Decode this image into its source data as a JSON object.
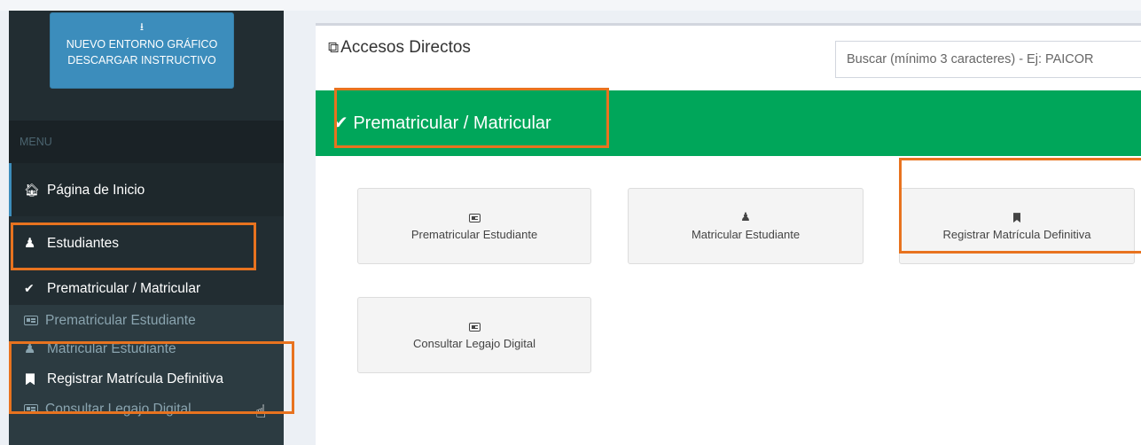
{
  "sidebar": {
    "download_button": {
      "icon": "download-icon",
      "line1": "NUEVO ENTORNO GRÁFICO",
      "line2": "DESCARGAR INSTRUCTIVO"
    },
    "menu_header": "MENU",
    "items": {
      "home": {
        "label": "Página de Inicio",
        "icon": "home-icon"
      },
      "estudiantes": {
        "label": "Estudiantes",
        "icon": "person-icon"
      },
      "prematricular_matricular": {
        "label": "Prematricular / Matricular",
        "icon": "check-icon"
      }
    },
    "subitems": [
      {
        "label": "Prematricular Estudiante",
        "icon": "id-card-icon"
      },
      {
        "label": "Matricular Estudiante",
        "icon": "person-icon"
      },
      {
        "label": "Registrar Matrícula Definitiva",
        "icon": "bookmark-icon"
      },
      {
        "label": "Consultar Legajo Digital",
        "icon": "id-card-icon"
      }
    ]
  },
  "main": {
    "title": "Accesos Directos",
    "search_placeholder": "Buscar (mínimo 3 caracteres) - Ej: PAICOR",
    "section_title": "Prematricular / Matricular",
    "tiles": [
      {
        "label": "Prematricular Estudiante",
        "icon": "id-card-icon"
      },
      {
        "label": "Matricular Estudiante",
        "icon": "person-icon"
      },
      {
        "label": "Registrar Matrícula Definitiva",
        "icon": "bookmark-icon"
      },
      {
        "label": "Consultar Legajo Digital",
        "icon": "id-card-icon"
      }
    ]
  },
  "colors": {
    "sidebar_bg": "#222d32",
    "accent_blue": "#3c8dbc",
    "section_green": "#00a65a",
    "highlight_orange": "#e8731f"
  }
}
